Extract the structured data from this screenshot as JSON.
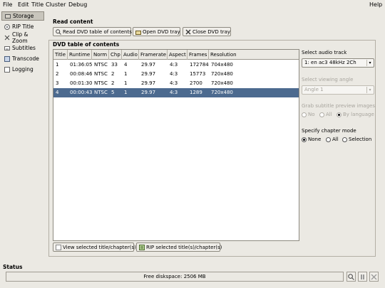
{
  "menu": {
    "items": [
      {
        "label": "File"
      },
      {
        "label": "Edit"
      },
      {
        "label": "Title"
      },
      {
        "label": "Cluster"
      },
      {
        "label": "Debug"
      }
    ],
    "help": "Help"
  },
  "sidebar": {
    "items": [
      {
        "label": "Storage",
        "icon": "storage-icon"
      },
      {
        "label": "RIP Title",
        "icon": "rip-title-icon"
      },
      {
        "label": "Clip & Zoom",
        "icon": "clip-zoom-icon"
      },
      {
        "label": "Subtitles",
        "icon": "subtitles-icon"
      },
      {
        "label": "Transcode",
        "icon": "transcode-icon"
      },
      {
        "label": "Logging",
        "icon": "logging-icon"
      }
    ]
  },
  "read_content": {
    "title": "Read content",
    "read_btn": "Read DVD table of contents",
    "open_btn": "Open DVD tray",
    "close_btn": "Close DVD tray"
  },
  "dvd_toc": {
    "title": "DVD table of contents",
    "columns": [
      "Title",
      "Runtime",
      "Norm",
      "Chp",
      "Audio",
      "Framerate",
      "Aspect",
      "Frames",
      "Resolution"
    ],
    "rows": [
      [
        "1",
        "01:36:05",
        "NTSC",
        "33",
        "4",
        "29.97",
        "4:3",
        "172784",
        "704x480"
      ],
      [
        "2",
        "00:08:46",
        "NTSC",
        "2",
        "1",
        "29.97",
        "4:3",
        "15773",
        "720x480"
      ],
      [
        "3",
        "00:01:30",
        "NTSC",
        "2",
        "1",
        "29.97",
        "4:3",
        "2700",
        "720x480"
      ],
      [
        "4",
        "00:00:43",
        "NTSC",
        "5",
        "1",
        "29.97",
        "4:3",
        "1289",
        "720x480"
      ]
    ],
    "selected_row": 3,
    "view_btn": "View selected title/chapter(s)",
    "rip_btn": "RIP selected title(s)/chapter(s)"
  },
  "right_panel": {
    "audio_label": "Select audio track",
    "audio_value": "1: en ac3 48kHz 2Ch",
    "angle_label": "Select viewing angle",
    "angle_value": "Angle 1",
    "subtitle_label": "Grab subtitle preview images",
    "subtitle_options": [
      "No",
      "All",
      "By language"
    ],
    "chapter_label": "Specify chapter mode",
    "chapter_options": [
      "None",
      "All",
      "Selection"
    ]
  },
  "status": {
    "title": "Status",
    "text": "Free diskspace: 2506 MB"
  },
  "colors": {
    "selection": "#4c6a8f",
    "background": "#ebe9e3"
  }
}
